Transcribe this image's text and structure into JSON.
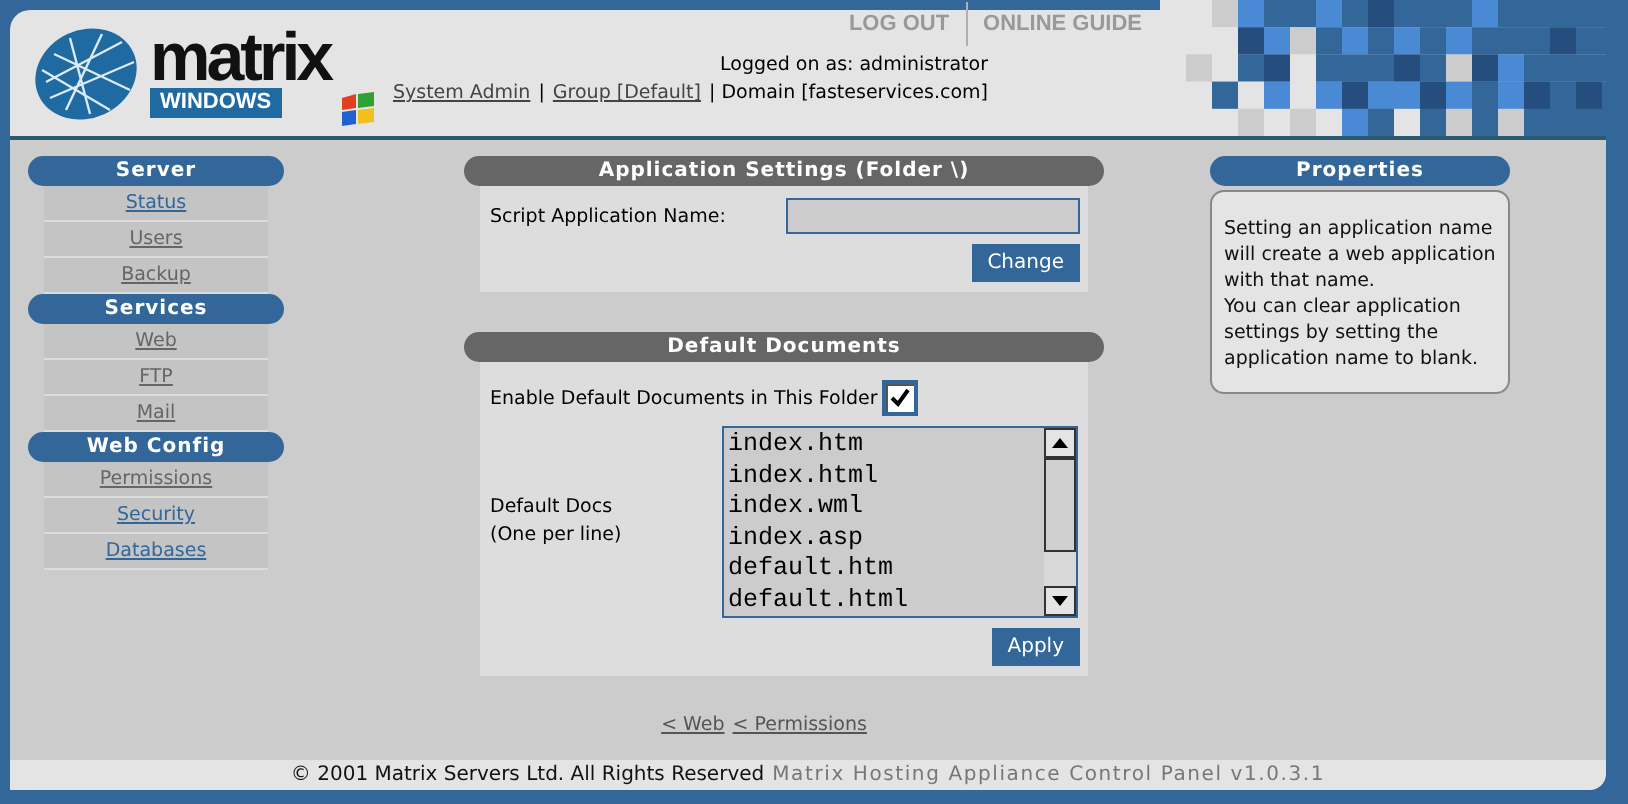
{
  "logo": {
    "name": "matrix",
    "badge": "WINDOWS"
  },
  "top_nav": [
    {
      "label": "LOG OUT"
    },
    {
      "label": "ONLINE GUIDE"
    }
  ],
  "login": "Logged on as: administrator",
  "breadcrumb": [
    {
      "kind": "link",
      "label": "System Admin"
    },
    {
      "kind": "text",
      "label": "|"
    },
    {
      "kind": "link",
      "label": "Group [Default]"
    },
    {
      "kind": "text",
      "label": "| Domain [fasteservices.com]"
    }
  ],
  "sidebar": [
    {
      "title": "Server",
      "items": [
        {
          "label": "Status",
          "visited": false
        },
        {
          "label": "Users",
          "visited": true
        },
        {
          "label": "Backup",
          "visited": true
        }
      ]
    },
    {
      "title": "Services",
      "items": [
        {
          "label": "Web",
          "visited": true
        },
        {
          "label": "FTP",
          "visited": true
        },
        {
          "label": "Mail",
          "visited": true
        }
      ]
    },
    {
      "title": "Web Config",
      "items": [
        {
          "label": "Permissions",
          "visited": true
        },
        {
          "label": "Security",
          "visited": false
        },
        {
          "label": "Databases",
          "visited": false
        }
      ]
    }
  ],
  "app_settings": {
    "title": "Application Settings (Folder \\)",
    "field_label": "Script Application Name:",
    "button": "Change"
  },
  "default_documents": {
    "title": "Default Documents",
    "enable_label": "Enable Default Documents in This Folder",
    "enabled": true,
    "docs_label": [
      "Default Docs",
      "(One per line)"
    ],
    "docs": [
      "index.htm",
      "index.html",
      "index.wml",
      "index.asp",
      "default.htm",
      "default.html"
    ],
    "button": "Apply"
  },
  "properties": {
    "title": "Properties",
    "paragraphs": [
      "Setting an application name will create a web application with that name.",
      "You can clear application settings by setting the application name to blank."
    ]
  },
  "bottom_nav": [
    "< Web",
    "< Permissions"
  ],
  "footer": {
    "copyright": "© 2001 Matrix Servers Ltd. All Rights Reserved",
    "product": "Matrix Hosting Appliance Control Panel v1.0.3.1"
  }
}
